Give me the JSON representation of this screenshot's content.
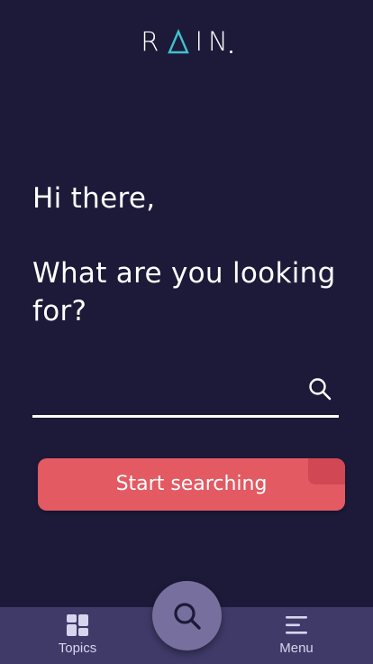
{
  "brand": {
    "name": "RAIN",
    "letters_before": "R",
    "letters_after": "IN",
    "accent_color": "#3fc1d0"
  },
  "hero": {
    "greeting": "Hi there,",
    "question": "What are you looking for?"
  },
  "search": {
    "placeholder": "",
    "value": "",
    "icon": "search-icon"
  },
  "cta": {
    "label": "Start searching",
    "color": "#e35a63"
  },
  "tabbar": {
    "tabs": [
      {
        "label": "Topics",
        "icon": "grid-icon"
      },
      {
        "label": "Menu",
        "icon": "hamburger-icon"
      }
    ],
    "center_button_icon": "search-icon"
  },
  "colors": {
    "background": "#1c1a38",
    "tabbar": "#3f3a68",
    "fab": "#77709e"
  }
}
